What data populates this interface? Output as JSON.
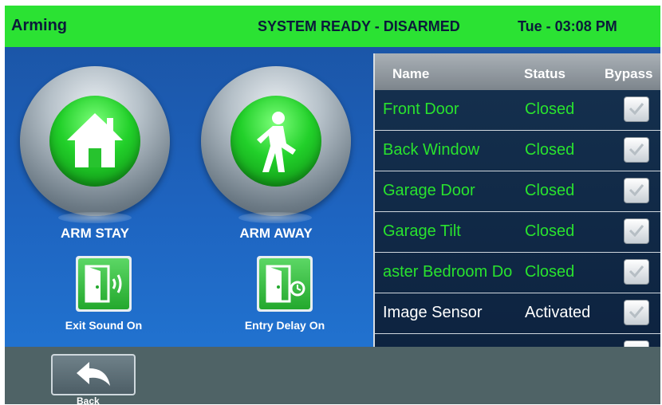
{
  "header": {
    "title": "Arming",
    "status": "SYSTEM READY - DISARMED",
    "datetime": "Tue - 03:08 PM"
  },
  "arm_buttons": {
    "stay_label": "ARM STAY",
    "away_label": "ARM AWAY"
  },
  "options": {
    "exit_sound_label": "Exit Sound On",
    "entry_delay_label": "Entry Delay On"
  },
  "zones": {
    "headers": {
      "name": "Name",
      "status": "Status",
      "bypass": "Bypass"
    },
    "rows": [
      {
        "name": "Front Door",
        "status": "Closed",
        "color": "#29e22e"
      },
      {
        "name": "Back Window",
        "status": "Closed",
        "color": "#29e22e"
      },
      {
        "name": "Garage Door",
        "status": "Closed",
        "color": "#29e22e"
      },
      {
        "name": "Garage Tilt",
        "status": "Closed",
        "color": "#29e22e"
      },
      {
        "name": "aster Bedroom Do",
        "status": "Closed",
        "color": "#29e22e"
      },
      {
        "name": "Image Sensor",
        "status": "Activated",
        "color": "#ffffff"
      }
    ]
  },
  "footer": {
    "back_label": "Back"
  },
  "colors": {
    "accent": "#2be233",
    "background": "#1e64c0",
    "footer": "#4f6366"
  }
}
